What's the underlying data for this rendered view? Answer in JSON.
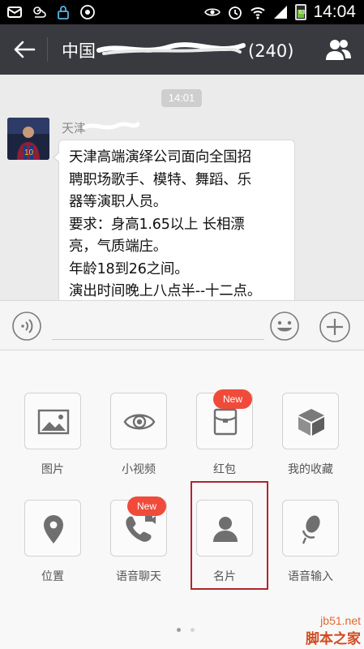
{
  "status_bar": {
    "time": "14:04",
    "battery_level": "63",
    "icons": [
      "mail-icon",
      "weather-icon",
      "lock-icon",
      "video-app-icon",
      "eye-icon",
      "alarm-icon",
      "wifi-icon",
      "signal-icon",
      "battery-icon"
    ]
  },
  "title_bar": {
    "title_start": "中国",
    "title_end": "(240)",
    "back_icon": "arrow-left-icon",
    "members_icon": "group-icon"
  },
  "chat": {
    "timestamp": "14:01",
    "sender_visible": "天津",
    "message_lines": [
      "天津高端演绎公司面向全国招",
      "聘职场歌手、模特、舞蹈、乐",
      "器等演职人员。",
      "要求：身高1.65以上 长相漂",
      "亮，气质端庄。",
      "年龄18到26之间。",
      "演出时间晚上八点半--十二点。"
    ]
  },
  "input_bar": {
    "value": "",
    "placeholder": ""
  },
  "panel": {
    "row1": [
      {
        "label": "图片",
        "icon": "image-icon"
      },
      {
        "label": "小视频",
        "icon": "eye-icon"
      },
      {
        "label": "红包",
        "icon": "red-packet-icon",
        "badge": "New"
      },
      {
        "label": "我的收藏",
        "icon": "cube-icon"
      }
    ],
    "row2": [
      {
        "label": "位置",
        "icon": "location-pin-icon"
      },
      {
        "label": "语音聊天",
        "icon": "voice-call-icon",
        "badge": "New"
      },
      {
        "label": "名片",
        "icon": "contact-card-icon"
      },
      {
        "label": "语音输入",
        "icon": "microphone-icon"
      }
    ],
    "page_indicator": {
      "current": 1,
      "total": 2
    }
  },
  "watermark": {
    "url": "jb51.net",
    "name": "脚本之家"
  }
}
